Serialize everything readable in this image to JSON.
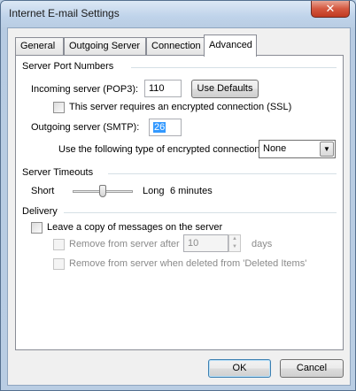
{
  "window": {
    "title": "Internet E-mail Settings",
    "close_glyph": "✕"
  },
  "tabs": [
    {
      "label": "General",
      "active": false
    },
    {
      "label": "Outgoing Server",
      "active": false
    },
    {
      "label": "Connection",
      "active": false
    },
    {
      "label": "Advanced",
      "active": true
    }
  ],
  "server_ports": {
    "heading": "Server Port Numbers",
    "incoming_label": "Incoming server (POP3):",
    "incoming_value": "110",
    "use_defaults_label": "Use Defaults",
    "ssl_label": "This server requires an encrypted connection (SSL)",
    "ssl_checked": false,
    "outgoing_label": "Outgoing server (SMTP):",
    "outgoing_value": "26",
    "encryption_label": "Use the following type of encrypted connection:",
    "encryption_value": "None"
  },
  "timeouts": {
    "heading": "Server Timeouts",
    "short_label": "Short",
    "long_label": "Long",
    "value_text": "6 minutes",
    "slider_fraction": 0.5
  },
  "delivery": {
    "heading": "Delivery",
    "leave_copy_label": "Leave a copy of messages on the server",
    "leave_copy_checked": false,
    "remove_after_label": "Remove from server after",
    "remove_after_value": "10",
    "days_label": "days",
    "remove_deleted_label": "Remove from server when deleted from 'Deleted Items'"
  },
  "buttons": {
    "ok_label": "OK",
    "cancel_label": "Cancel"
  }
}
